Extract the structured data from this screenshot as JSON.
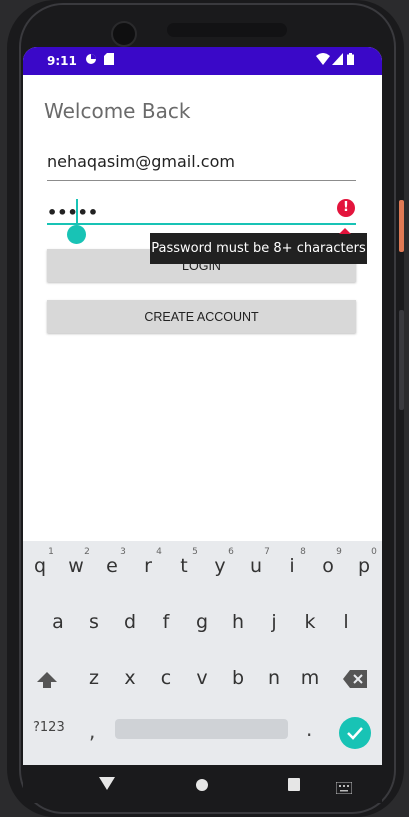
{
  "status_bar": {
    "time": "9:11",
    "icons": [
      "data-saver-icon",
      "sd-card-icon",
      "wifi-icon",
      "signal-icon",
      "battery-icon"
    ],
    "bg_color": "#3a08c8"
  },
  "screen": {
    "title": "Welcome Back",
    "email_value": "nehaqasim@gmail.com",
    "password_value": "•••••",
    "password_error": "Password must be 8+ characters",
    "login_button": "LOGIN",
    "create_account_button": "CREATE ACCOUNT",
    "accent_color": "#18c3b5",
    "error_color": "#e3143c"
  },
  "keyboard": {
    "row1": [
      "q",
      "w",
      "e",
      "r",
      "t",
      "y",
      "u",
      "i",
      "o",
      "p"
    ],
    "row1_hints": [
      "1",
      "2",
      "3",
      "4",
      "5",
      "6",
      "7",
      "8",
      "9",
      "0"
    ],
    "row2": [
      "a",
      "s",
      "d",
      "f",
      "g",
      "h",
      "j",
      "k",
      "l"
    ],
    "row3": [
      "z",
      "x",
      "c",
      "v",
      "b",
      "n",
      "m"
    ],
    "symbols_key": "?123",
    "comma_key": ",",
    "period_key": "."
  },
  "nav_bar": {
    "icons": [
      "back-icon",
      "home-icon",
      "recents-icon",
      "keyboard-switch-icon"
    ]
  }
}
